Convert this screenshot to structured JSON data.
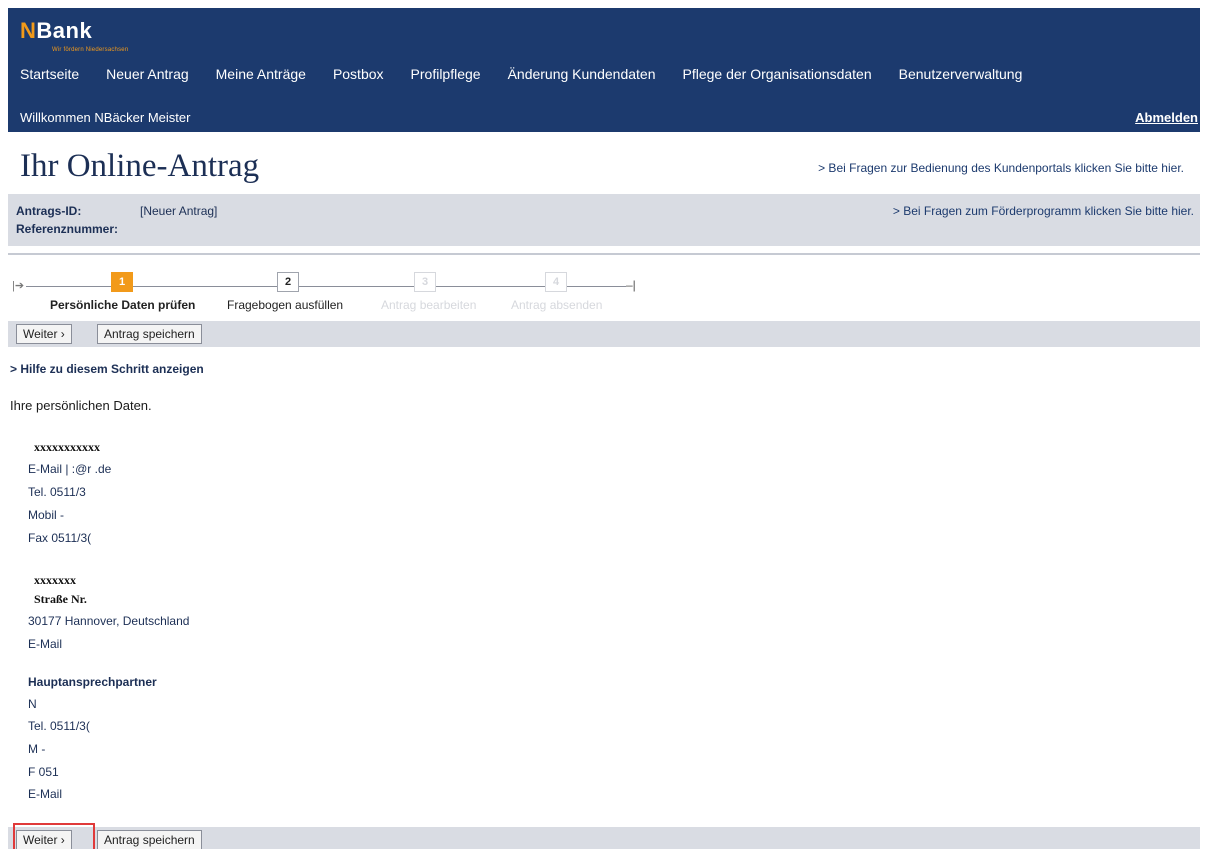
{
  "header": {
    "logo_text": "NBank",
    "logo_tagline": "Wir fördern Niedersachsen",
    "nav": [
      "Startseite",
      "Neuer Antrag",
      "Meine Anträge",
      "Postbox",
      "Profilpflege",
      "Änderung Kundendaten",
      "Pflege der Organisationsdaten",
      "Benutzerverwaltung"
    ],
    "welcome": "Willkommen NBäcker Meister",
    "logout": "Abmelden"
  },
  "page": {
    "title": "Ihr Online-Antrag",
    "help_portal": "> Bei Fragen zur Bedienung des Kundenportals klicken Sie bitte hier.",
    "help_program": "> Bei Fragen zum Förderprogramm klicken Sie bitte hier."
  },
  "info": {
    "antrags_id_label": "Antrags-ID:",
    "antrags_id_value": "[Neuer Antrag]",
    "referenz_label": "Referenznummer:"
  },
  "steps": [
    {
      "number": "1",
      "label": "Persönliche Daten prüfen",
      "state": "active"
    },
    {
      "number": "2",
      "label": "Fragebogen ausfüllen",
      "state": "normal"
    },
    {
      "number": "3",
      "label": "Antrag bearbeiten",
      "state": "disabled"
    },
    {
      "number": "4",
      "label": "Antrag absenden",
      "state": "disabled"
    }
  ],
  "toolbar": {
    "weiter": "Weiter ›",
    "save": "Antrag speichern"
  },
  "help_step": "> Hilfe zu diesem Schritt anzeigen",
  "intro": "Ihre persönlichen Daten.",
  "person": {
    "name": "xxxxxxxxxxx",
    "email": "E-Mail |              :@r        .de",
    "tel": "Tel. 0511/3",
    "mobil": "Mobil -",
    "fax": "Fax 0511/3("
  },
  "organisation": {
    "name": "xxxxxxx",
    "street": "Straße Nr.",
    "city": "30177 Hannover, Deutschland",
    "email": "E-Mail"
  },
  "contact": {
    "heading": "Hauptansprechpartner",
    "name": "N",
    "tel": "Tel. 0511/3(",
    "mobil": "M -",
    "fax": "F 051",
    "email": "E-Mail"
  },
  "colors": {
    "header_bg": "#1c3a6e",
    "accent_orange": "#f29a1a",
    "bar_bg": "#d9dce3",
    "highlight_red": "#e03a3a"
  }
}
